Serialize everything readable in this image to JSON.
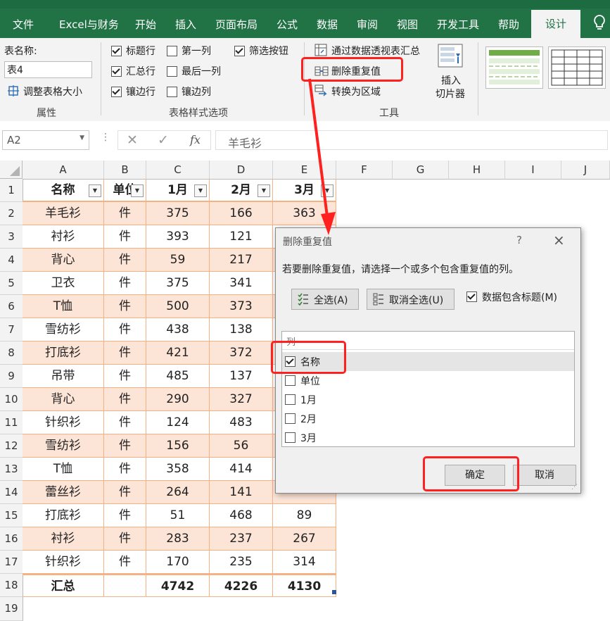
{
  "ribbon_tabs": [
    "文件",
    "Excel与财务",
    "开始",
    "插入",
    "页面布局",
    "公式",
    "数据",
    "审阅",
    "视图",
    "开发工具",
    "帮助",
    "设计"
  ],
  "active_tab": "设计",
  "properties": {
    "table_name_label": "表名称:",
    "table_name_value": "表4",
    "resize_label": "调整表格大小",
    "group_title": "属性"
  },
  "style_options": {
    "group_title": "表格样式选项",
    "header_row": "标题行",
    "total_row": "汇总行",
    "banded_rows": "镶边行",
    "first_column": "第一列",
    "last_column": "最后一列",
    "banded_columns": "镶边列",
    "filter_button": "筛选按钮"
  },
  "tools": {
    "group_title": "工具",
    "pivot_summary": "通过数据透视表汇总",
    "remove_duplicates": "删除重复值",
    "convert_to_range": "转换为区域",
    "insert_slicer_line1": "插入",
    "insert_slicer_line2": "切片器"
  },
  "formula_bar": {
    "name_box": "A2",
    "fx": "fx",
    "content": "羊毛衫"
  },
  "column_headers": [
    "A",
    "B",
    "C",
    "D",
    "E",
    "F",
    "G",
    "H",
    "I",
    "J"
  ],
  "table": {
    "headers": [
      "名称",
      "单位",
      "1月",
      "2月",
      "3月"
    ],
    "rows": [
      [
        "羊毛衫",
        "件",
        "375",
        "166",
        "363"
      ],
      [
        "衬衫",
        "件",
        "393",
        "121",
        ""
      ],
      [
        "背心",
        "件",
        "59",
        "217",
        ""
      ],
      [
        "卫衣",
        "件",
        "375",
        "341",
        ""
      ],
      [
        "T恤",
        "件",
        "500",
        "373",
        ""
      ],
      [
        "雪纺衫",
        "件",
        "438",
        "138",
        ""
      ],
      [
        "打底衫",
        "件",
        "421",
        "372",
        ""
      ],
      [
        "吊带",
        "件",
        "485",
        "137",
        ""
      ],
      [
        "背心",
        "件",
        "290",
        "327",
        ""
      ],
      [
        "针织衫",
        "件",
        "124",
        "483",
        ""
      ],
      [
        "雪纺衫",
        "件",
        "156",
        "56",
        ""
      ],
      [
        "T恤",
        "件",
        "358",
        "414",
        ""
      ],
      [
        "蕾丝衫",
        "件",
        "264",
        "141",
        ""
      ],
      [
        "打底衫",
        "件",
        "51",
        "468",
        "89"
      ],
      [
        "衬衫",
        "件",
        "283",
        "237",
        "267"
      ],
      [
        "针织衫",
        "件",
        "170",
        "235",
        "314"
      ]
    ],
    "total_row": [
      "汇总",
      "",
      "4742",
      "4226",
      "4130"
    ]
  },
  "dialog": {
    "title": "删除重复值",
    "help": "?",
    "close": "×",
    "instruction": "若要删除重复值，请选择一个或多个包含重复值的列。",
    "select_all": "全选(A)",
    "unselect_all": "取消全选(U)",
    "has_headers": "数据包含标题(M)",
    "list_header": "列",
    "columns": [
      {
        "label": "名称",
        "checked": true
      },
      {
        "label": "单位",
        "checked": false
      },
      {
        "label": "1月",
        "checked": false
      },
      {
        "label": "2月",
        "checked": false
      },
      {
        "label": "3月",
        "checked": false
      }
    ],
    "ok": "确定",
    "cancel": "取消"
  },
  "colors": {
    "excel_green": "#217346",
    "band_orange": "#fce4d6",
    "table_border": "#f4b183",
    "highlight_red": "#ff2020"
  }
}
